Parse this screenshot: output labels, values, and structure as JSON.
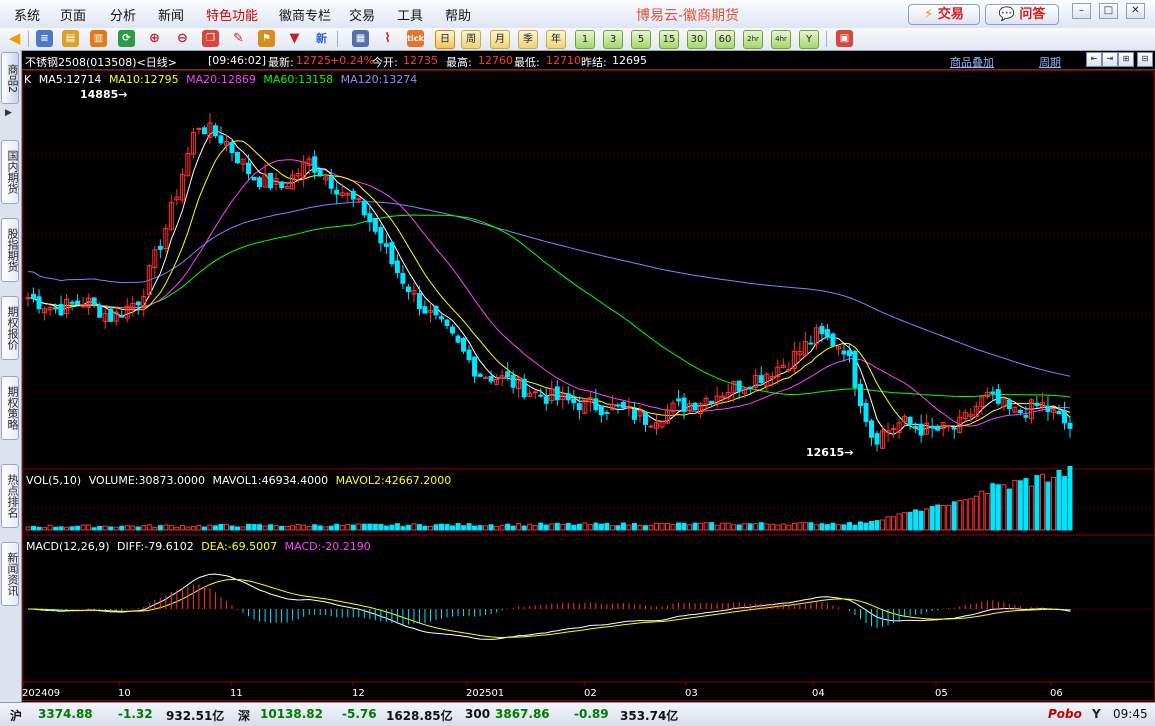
{
  "menu": {
    "items": [
      "系统",
      "页面",
      "分析",
      "新闻",
      "特色功能",
      "徽商专栏",
      "交易",
      "工具",
      "帮助"
    ],
    "highlight": "特色功能",
    "brand": "博易云-徽商期货",
    "trade_button": "交易",
    "ask_button": "问答"
  },
  "toolbar": {
    "periods": [
      "日",
      "周",
      "月",
      "季",
      "年",
      "1",
      "3",
      "5",
      "15",
      "30",
      "60",
      "2hr",
      "4hr",
      "Y"
    ],
    "selected_period": "日"
  },
  "sidebar": {
    "tabs": [
      "商品2",
      "国内期货",
      "股指期货",
      "期权报价",
      "期权策略",
      "热点排名",
      "新闻资讯"
    ],
    "active": "商品2"
  },
  "info": {
    "contract": "不锈钢2508(013508)<日线>",
    "time": "[09:46:02]",
    "latest_label": "最新:",
    "latest": "12725",
    "change": "+0.24%",
    "open_label": "今开:",
    "open": "12735",
    "high_label": "最高:",
    "high": "12760",
    "low_label": "最低:",
    "low": "12710",
    "prev_label": "昨结:",
    "prev": "12695",
    "overlay_link": "商品叠加",
    "period_link": "周期"
  },
  "ma_legend": {
    "k": "K",
    "ma5": "MA5:12714",
    "ma10": "MA10:12795",
    "ma20": "MA20:12869",
    "ma60": "MA60:13158",
    "ma120": "MA120:13274"
  },
  "vol_legend": {
    "name": "VOL(5,10)",
    "volume": "VOLUME:30873.0000",
    "mavol1": "MAVOL1:46934.4000",
    "mavol2": "MAVOL2:42667.2000"
  },
  "macd_legend": {
    "name": "MACD(12,26,9)",
    "diff": "DIFF:-79.6102",
    "dea": "DEA:-69.5007",
    "macd": "MACD:-20.2190"
  },
  "chart_data": {
    "type": "candlestick",
    "high_marker": "14885",
    "low_marker": "12615",
    "price_range": [
      12500,
      15050
    ],
    "x_labels": [
      "202409",
      "10",
      "11",
      "12",
      "202501",
      "02",
      "03",
      "04",
      "05",
      "06"
    ],
    "trend": [
      13620,
      13540,
      13600,
      13480,
      13620,
      14160,
      14820,
      14700,
      14450,
      14380,
      14560,
      14380,
      14200,
      13830,
      13560,
      13350,
      13100,
      13050,
      12960,
      12910,
      12880,
      12850,
      12780,
      12860,
      12920,
      13000,
      13080,
      13180,
      13360,
      13280,
      12650,
      12760,
      12700,
      12720,
      12940,
      12820,
      12880,
      12725
    ],
    "colors": {
      "up": "#ff3232",
      "down": "#00e5ff",
      "ma5": "#ffffff",
      "ma10": "#ffff00",
      "ma20": "#ff40ff",
      "ma60": "#00ff00",
      "ma120": "#8080ff"
    }
  },
  "status": {
    "sh_label": "沪",
    "sh_index": "3374.88",
    "sh_change": "-1.32",
    "sh_amount": "932.51亿",
    "sz_label": "深",
    "sz_index": "10138.82",
    "sz_change": "-5.76",
    "sz_amount": "1628.85亿",
    "hs300_label": "300",
    "hs300_index": "3867.86",
    "hs300_change": "-0.89",
    "hs300_amount": "353.74亿",
    "logo": "Pobo",
    "clock": "09:45"
  }
}
